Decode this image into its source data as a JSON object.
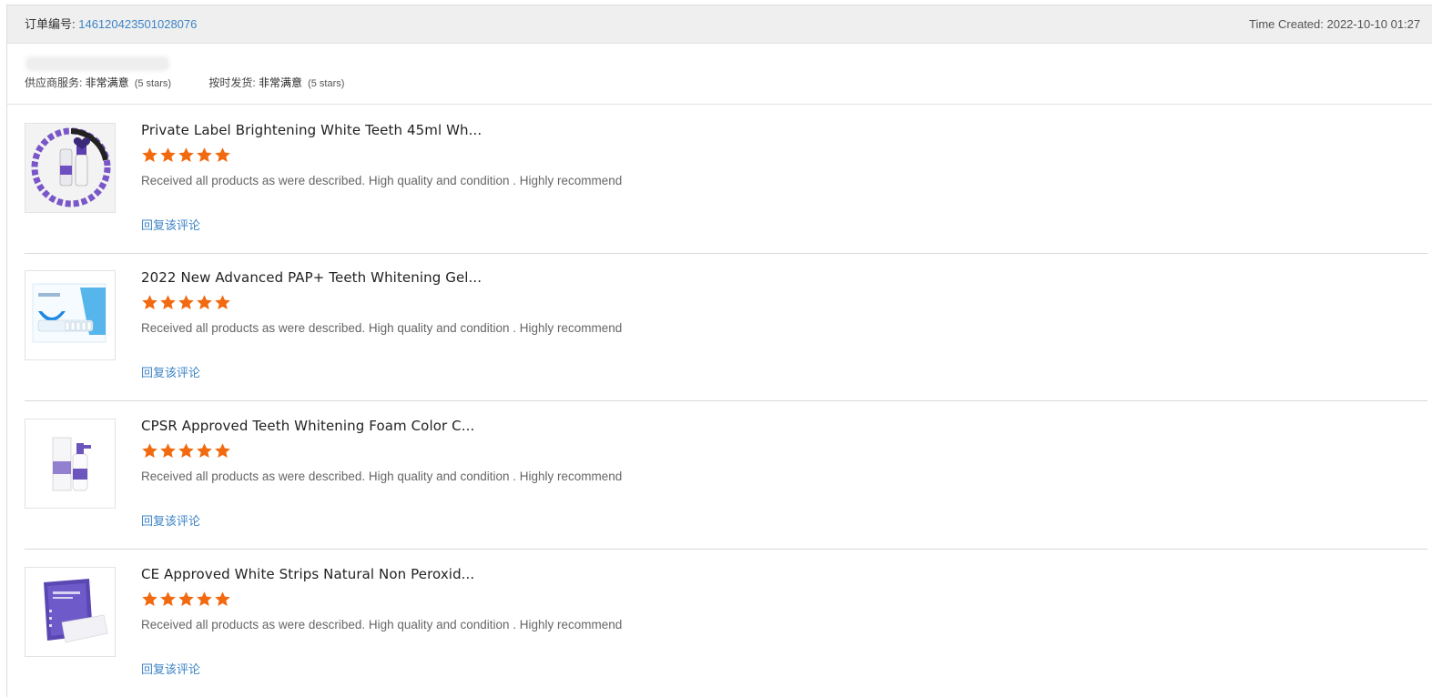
{
  "order": {
    "label": "订单编号: ",
    "number": "146120423501028076",
    "time_created": "Time Created: 2022-10-10 01:27"
  },
  "ratings": [
    {
      "label": "供应商服务: ",
      "value": "非常满意",
      "note": "(5 stars)",
      "stars": 5
    },
    {
      "label": "按时发货: ",
      "value": "非常满意",
      "note": "(5 stars)",
      "stars": 5
    }
  ],
  "colors": {
    "star": "#f26a10",
    "link": "#3d84c6",
    "header_bg": "#efefef"
  },
  "reviews": [
    {
      "title": "Private Label Brightening White Teeth 45ml Wh...",
      "stars": 5,
      "text": "Received all products as were described. High quality and condition . Highly recommend",
      "reply_label": "回复该评论"
    },
    {
      "title": "2022 New Advanced PAP+ Teeth Whitening Gel...",
      "stars": 5,
      "text": "Received all products as were described. High quality and condition . Highly recommend",
      "reply_label": "回复该评论"
    },
    {
      "title": "CPSR Approved Teeth Whitening Foam Color C...",
      "stars": 5,
      "text": "Received all products as were described. High quality and condition . Highly recommend",
      "reply_label": "回复该评论"
    },
    {
      "title": "CE Approved White Strips Natural Non Peroxid...",
      "stars": 5,
      "text": "Received all products as were described. High quality and condition . Highly recommend",
      "reply_label": "回复该评论"
    }
  ]
}
